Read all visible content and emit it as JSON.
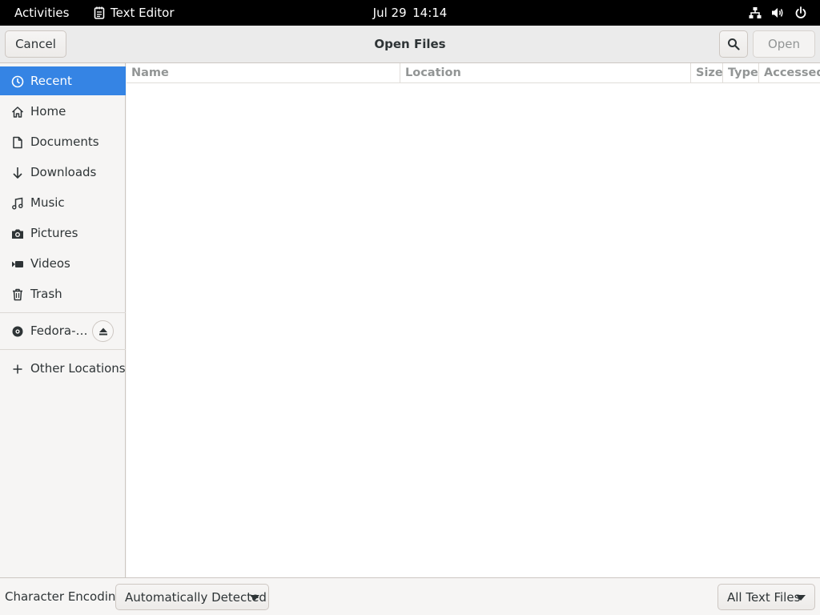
{
  "topbar": {
    "activities": "Activities",
    "app_name": "Text Editor",
    "clock_date": "Jul 29",
    "clock_time": "14:14",
    "icons": [
      "network-icon",
      "volume-icon",
      "power-icon"
    ]
  },
  "dialog": {
    "title": "Open Files",
    "cancel_label": "Cancel",
    "open_label": "Open",
    "search_icon": "search-icon"
  },
  "sidebar": {
    "items": [
      {
        "label": "Recent",
        "icon": "clock-icon",
        "active": true
      },
      {
        "label": "Home",
        "icon": "home-icon"
      },
      {
        "label": "Documents",
        "icon": "document-icon"
      },
      {
        "label": "Downloads",
        "icon": "download-icon"
      },
      {
        "label": "Music",
        "icon": "music-icon"
      },
      {
        "label": "Pictures",
        "icon": "camera-icon"
      },
      {
        "label": "Videos",
        "icon": "video-icon"
      },
      {
        "label": "Trash",
        "icon": "trash-icon"
      }
    ],
    "device": {
      "label": "Fedora-…",
      "icon": "disc-icon",
      "action_icon": "eject-icon"
    },
    "other_locations": {
      "label": "Other Locations",
      "icon": "plus-icon"
    }
  },
  "filelist": {
    "columns": [
      "Name",
      "Location",
      "Size",
      "Type",
      "Accessed"
    ],
    "rows": []
  },
  "bottombar": {
    "encoding_label": "Character Encoding:",
    "encoding_value": "Automatically Detected",
    "filter_value": "All Text Files"
  },
  "colors": {
    "accent": "#3584e4",
    "topbar_bg": "#000000",
    "headerbar_bg": "#ebebeb",
    "sidebar_bg": "#f6f5f4"
  }
}
